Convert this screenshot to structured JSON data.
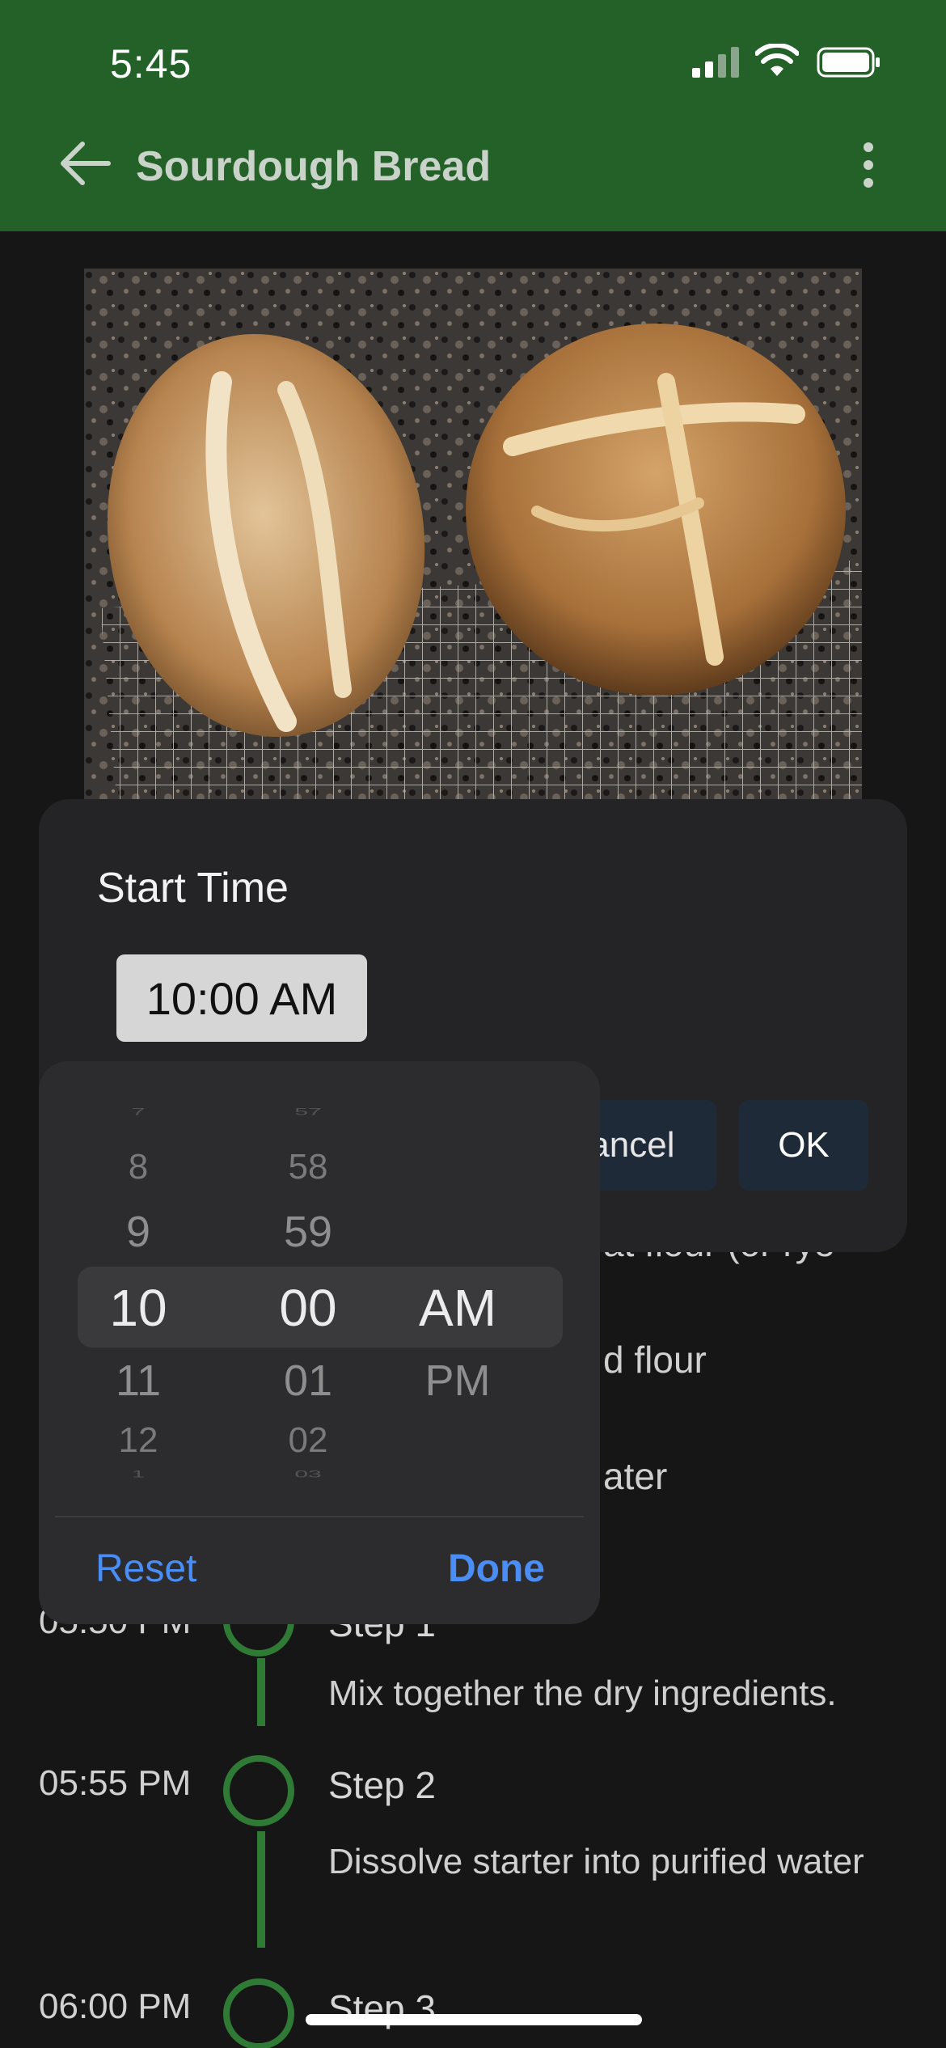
{
  "status": {
    "time": "5:45"
  },
  "header": {
    "title": "Sourdough Bread",
    "back_icon": "arrow-left-icon",
    "menu_icon": "more-vert-icon"
  },
  "hero": {
    "alt": "Two loaves of sourdough bread on a cooling rack"
  },
  "ingredients_visible": [
    {
      "text": "…at flour (or rye"
    },
    {
      "text": "…d flour"
    },
    {
      "text": "…ater"
    }
  ],
  "timeline": [
    {
      "time": "05:50 PM",
      "step": "Step 1",
      "desc": "Mix together the dry ingredients."
    },
    {
      "time": "05:55 PM",
      "step": "Step 2",
      "desc": "Dissolve starter into purified water"
    },
    {
      "time": "06:00 PM",
      "step": "Step 3",
      "desc": ""
    }
  ],
  "dialog": {
    "title": "Start Time",
    "time_value": "10:00 AM",
    "cancel_label": "Cancel",
    "ok_label": "OK"
  },
  "picker": {
    "hours": [
      "7",
      "8",
      "9",
      "10",
      "11",
      "12",
      "1"
    ],
    "minutes": [
      "57",
      "58",
      "59",
      "00",
      "01",
      "02",
      "03"
    ],
    "periods": [
      "AM",
      "PM"
    ],
    "selected": {
      "hour": "10",
      "minute": "00",
      "period": "AM"
    },
    "reset_label": "Reset",
    "done_label": "Done"
  },
  "colors": {
    "app_bar": "#236128",
    "accent_green": "#2f7a35",
    "link_blue": "#4a8ef5"
  }
}
